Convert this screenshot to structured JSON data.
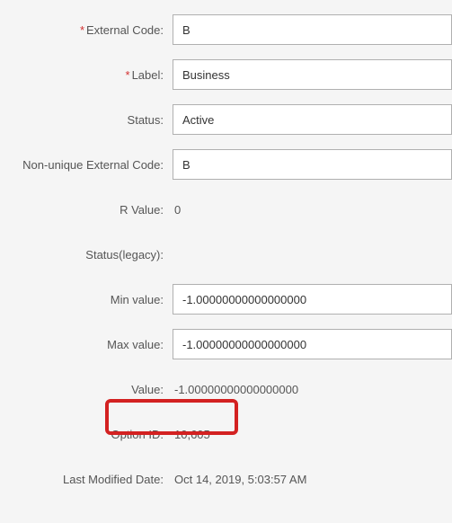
{
  "fields": {
    "externalCode": {
      "label": "External Code:",
      "value": "B",
      "required": true
    },
    "label": {
      "label": "Label:",
      "value": "Business",
      "required": true
    },
    "status": {
      "label": "Status:",
      "value": "Active",
      "required": false
    },
    "nonUniqueExternalCode": {
      "label": "Non-unique External Code:",
      "value": "B",
      "required": false
    },
    "rValue": {
      "label": "R Value:",
      "value": "0"
    },
    "statusLegacy": {
      "label": "Status(legacy):",
      "value": ""
    },
    "minValue": {
      "label": "Min value:",
      "value": "-1.00000000000000000"
    },
    "maxValue": {
      "label": "Max value:",
      "value": "-1.00000000000000000"
    },
    "value": {
      "label": "Value:",
      "value": "-1.00000000000000000"
    },
    "optionId": {
      "label": "Option ID:",
      "value": "10,605"
    },
    "lastModifiedDate": {
      "label": "Last Modified Date:",
      "value": "Oct 14, 2019, 5:03:57 AM"
    }
  }
}
